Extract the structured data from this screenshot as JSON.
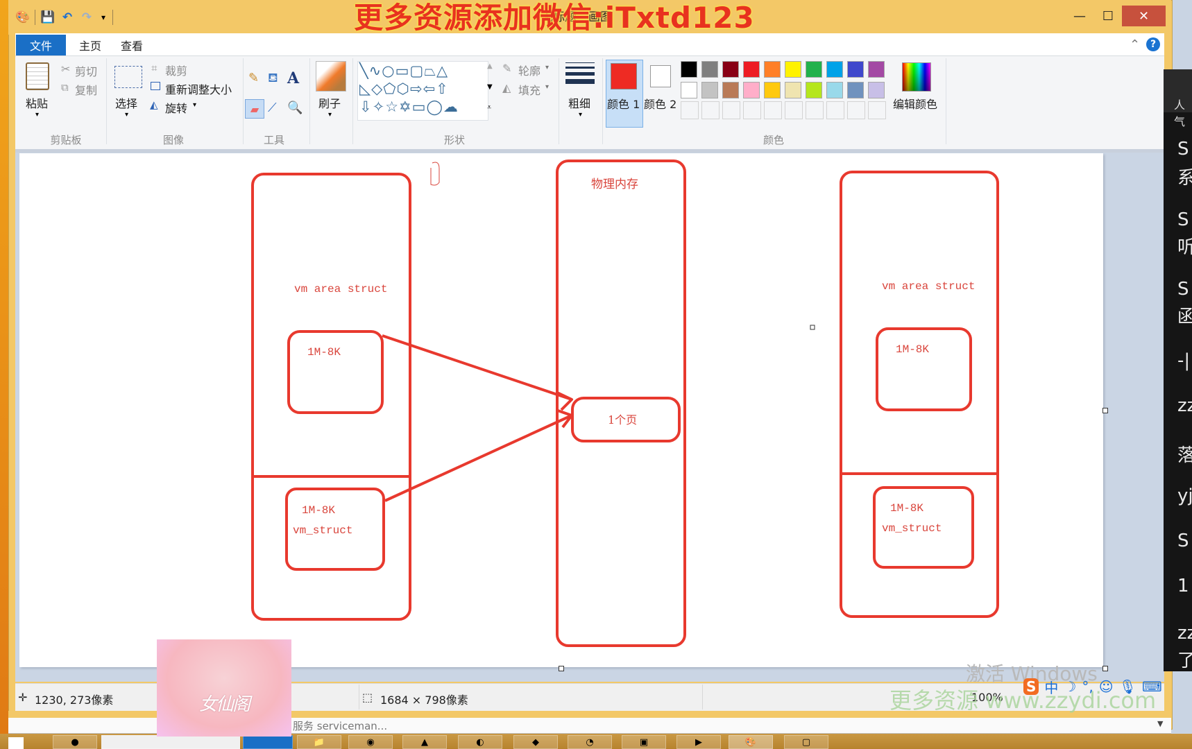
{
  "window": {
    "title": "无标题 - 画图",
    "watermark_top": "更多资源添加微信:iTxtd123",
    "controls": {
      "minimize": "—",
      "maximize": "☐",
      "close": "✕"
    },
    "qat": [
      "paint-app-icon",
      "save-icon",
      "undo-icon",
      "redo-icon",
      "customize-qat-icon"
    ]
  },
  "tabs": [
    {
      "label": "文件",
      "active": true
    },
    {
      "label": "主页",
      "active": false
    },
    {
      "label": "查看",
      "active": false
    }
  ],
  "ribbon": {
    "clipboard": {
      "group_label": "剪贴板",
      "paste": "粘贴",
      "cut": "剪切",
      "copy": "复制"
    },
    "image": {
      "group_label": "图像",
      "select": "选择",
      "crop": "裁剪",
      "resize": "重新调整大小",
      "rotate": "旋转"
    },
    "tools": {
      "group_label": "工具"
    },
    "brushes": {
      "label": "刷子"
    },
    "shapes": {
      "group_label": "形状",
      "outline": "轮廓",
      "fill": "填充"
    },
    "size": {
      "label": "粗细"
    },
    "colors": {
      "group_label": "颜色",
      "color1_label": "颜色 1",
      "color2_label": "颜色 2",
      "color1": "#ee2b23",
      "color2": "#ffffff",
      "edit_colors": "编辑颜色",
      "palette_row1": [
        "#000000",
        "#7f7f7f",
        "#880015",
        "#ed1c24",
        "#ff7f27",
        "#fff200",
        "#22b14c",
        "#00a2e8",
        "#3f48cc",
        "#a349a4"
      ],
      "palette_row2": [
        "#ffffff",
        "#c3c3c3",
        "#b97a57",
        "#ffaec9",
        "#ffc90e",
        "#efe4b0",
        "#b5e61d",
        "#99d9ea",
        "#7092be",
        "#c8bfe7"
      ]
    }
  },
  "drawing": {
    "stroke_color": "#e8392e",
    "text_color": "#d9453c",
    "left_column": {
      "label": "vm area struct",
      "top_box": "1M-8K",
      "bottom_box_line1": "1M-8K",
      "bottom_box_line2": "vm_struct"
    },
    "center_column": {
      "title": "物理内存",
      "page_box": "1个页"
    },
    "right_column": {
      "label": "vm area struct",
      "top_box": "1M-8K",
      "bottom_box_line1": "1M-8K",
      "bottom_box_line2": "vm_struct"
    }
  },
  "statusbar": {
    "cursor_position": "1230, 273像素",
    "canvas_size": "1684 × 798像素",
    "zoom": "100%"
  },
  "overlays": {
    "avatar_text": "女仙阁",
    "activate_windows": "激活 Windows",
    "watermark_bottom": "更多资源 www.zzydi.com",
    "behind_window_text": "服务 serviceman..."
  },
  "side_panel": {
    "header": "人气",
    "items": [
      "S",
      "系",
      "S",
      "听",
      "S",
      "函",
      "-|",
      "zz",
      "落",
      "yj",
      "S",
      "1",
      "zz",
      "了"
    ]
  },
  "tray": [
    "sogou-ime-icon",
    "chinese-mode-icon",
    "moon-icon",
    "punct-icon",
    "emoji-icon",
    "mic-icon",
    "keyboard-icon"
  ]
}
